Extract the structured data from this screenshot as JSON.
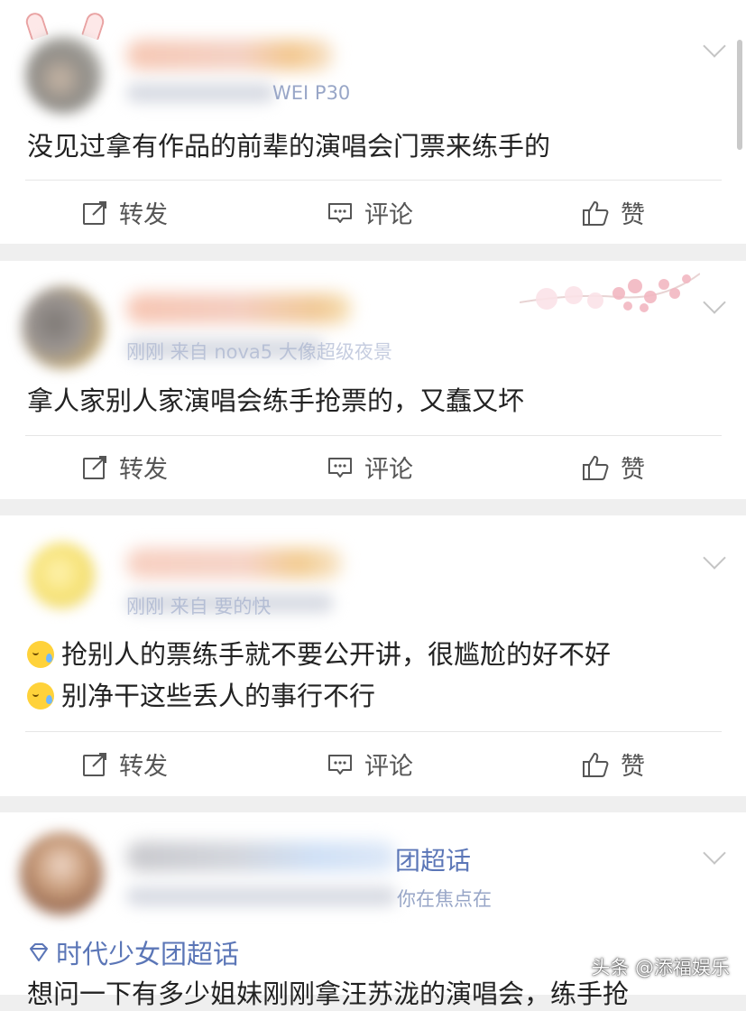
{
  "posts": [
    {
      "meta_visible": "WEI P30",
      "text_lines": [
        "没见过拿有作品的前辈的演唱会门票来练手的"
      ],
      "emoji_icon": "none"
    },
    {
      "meta_visible": "刚刚  来自 nova5 大像超级夜景",
      "text_lines": [
        "拿人家别人家演唱会练手抢票的，又蠢又坏"
      ],
      "emoji_icon": "none"
    },
    {
      "meta_visible": "刚刚  来自                要的快",
      "text_lines": [
        "抢别人的票练手就不要公开讲，很尴尬的好不好",
        "别净干这些丢人的事行不行"
      ],
      "emoji_icon": "sweat-smile-emoji-icon"
    },
    {
      "name_suffix": "团超话",
      "meta_visible": "你在焦点在",
      "topic": "时代少女团超话",
      "partial_text": "想问一下有多少姐妹刚刚拿汪苏泷的演唱会，练手抢"
    }
  ],
  "actions": {
    "forward": "转发",
    "comment": "评论",
    "like": "赞"
  },
  "icons": {
    "forward": "share-edit-icon",
    "comment": "comment-icon",
    "like": "thumbs-up-icon",
    "topic": "diamond-topic-icon",
    "menu": "chevron-down-icon"
  },
  "watermark": "头条 @添福娱乐",
  "colors": {
    "meta": "#98a6c7",
    "topic": "#5b76b7",
    "text": "#222222",
    "action": "#555555",
    "separator": "#efefef"
  }
}
